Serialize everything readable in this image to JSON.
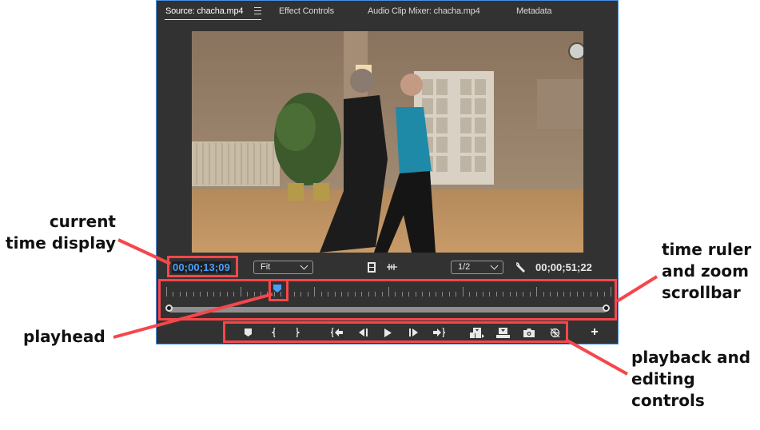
{
  "panel": {
    "tabs": [
      {
        "label": "Source: chacha.mp4",
        "active": true
      },
      {
        "label": "Effect Controls",
        "active": false
      },
      {
        "label": "Audio Clip Mixer: chacha.mp4",
        "active": false
      },
      {
        "label": "Metadata",
        "active": false
      }
    ],
    "tab_menu_icon": "hamburger-menu-icon",
    "accent_color": "#4a9eff"
  },
  "video": {
    "description": "Frame of a couple dancing cha-cha in a ballroom with potted plant, radiator, French doors and wall clock"
  },
  "controls_bar": {
    "current_time": "00;00;13;09",
    "zoom_select": {
      "value": "Fit"
    },
    "resolution_select": {
      "value": "1/2"
    },
    "icons": [
      "drag-video-only-icon",
      "drag-audio-only-icon",
      "settings-wrench-icon"
    ],
    "duration": "00;00;51;22"
  },
  "ruler": {
    "playhead_fraction": 0.25,
    "zoom_range": [
      0.0,
      1.0
    ]
  },
  "transport": {
    "buttons": [
      {
        "name": "add-marker-button",
        "icon": "marker-icon",
        "title": "Add Marker"
      },
      {
        "name": "mark-in-button",
        "icon": "mark-in-icon",
        "title": "Mark In"
      },
      {
        "name": "mark-out-button",
        "icon": "mark-out-icon",
        "title": "Mark Out"
      },
      {
        "name": "go-to-in-button",
        "icon": "go-to-in-icon",
        "title": "Go to In"
      },
      {
        "name": "step-back-button",
        "icon": "step-back-icon",
        "title": "Step Back 1 Frame"
      },
      {
        "name": "play-button",
        "icon": "play-icon",
        "title": "Play-Stop Toggle"
      },
      {
        "name": "step-forward-button",
        "icon": "step-forward-icon",
        "title": "Step Forward 1 Frame"
      },
      {
        "name": "go-to-out-button",
        "icon": "go-to-out-icon",
        "title": "Go to Out"
      },
      {
        "name": "insert-button",
        "icon": "insert-icon",
        "title": "Insert"
      },
      {
        "name": "overwrite-button",
        "icon": "overwrite-icon",
        "title": "Overwrite"
      },
      {
        "name": "export-frame-button",
        "icon": "camera-icon",
        "title": "Export Frame"
      },
      {
        "name": "vr-video-button",
        "icon": "vr-toggle-icon",
        "title": "Toggle VR Video Display"
      }
    ],
    "add_button": "+"
  },
  "annotations": {
    "current_time_label": [
      "current",
      "time display"
    ],
    "ruler_label": [
      "time ruler",
      "and zoom",
      "scrollbar"
    ],
    "playhead_label": "playhead",
    "controls_label": [
      "playback and",
      "editing",
      "controls"
    ],
    "highlight_color": "#f5474a"
  }
}
